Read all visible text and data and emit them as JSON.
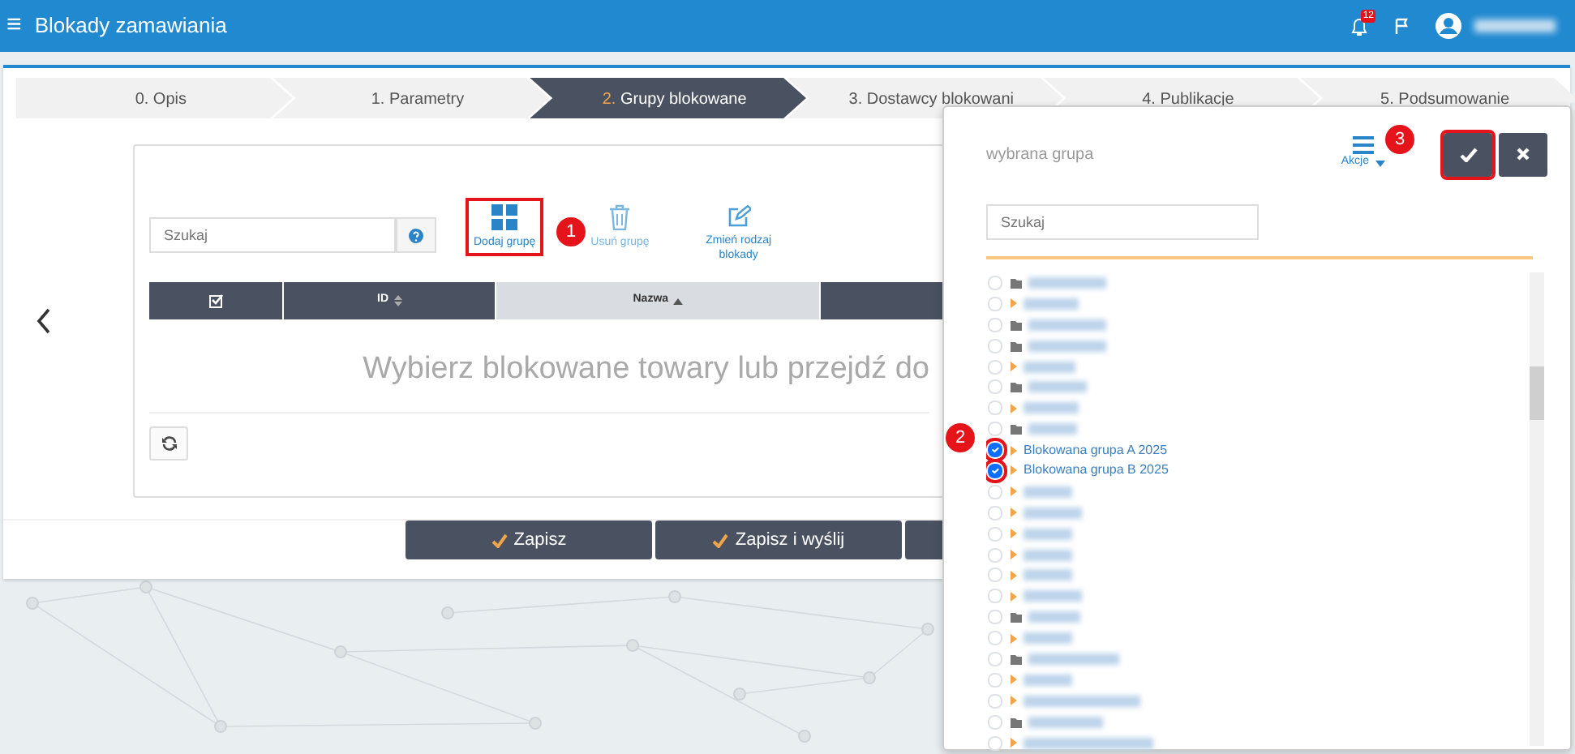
{
  "app": {
    "menu_icon": "≡",
    "title": "Blokady zamawiania",
    "notifications": "12"
  },
  "steps": [
    {
      "number": "0.",
      "label": "Opis",
      "selected": false
    },
    {
      "number": "1.",
      "label": "Parametry",
      "selected": false
    },
    {
      "number": "2.",
      "label": "Grupy blokowane",
      "selected": true
    },
    {
      "number": "3.",
      "label": "Dostawcy blokowani",
      "selected": false
    },
    {
      "number": "4.",
      "label": "Publikacje",
      "selected": false
    },
    {
      "number": "5.",
      "label": "Podsumowanie",
      "selected": false
    }
  ],
  "toolbar": {
    "search": {
      "placeholder": "Szukaj"
    },
    "actions": [
      {
        "kind": "add",
        "label": "Dodaj grupę",
        "highlighted": true
      },
      {
        "kind": "delete",
        "label": "Usuń grupę",
        "highlighted": false
      },
      {
        "kind": "edit",
        "label": "Zmień rodzaj blokady",
        "highlighted": false
      }
    ]
  },
  "table": {
    "columns": [
      {
        "kind": "select",
        "sorted": false
      },
      {
        "kind": "text",
        "label": "ID",
        "sorted": false
      },
      {
        "kind": "text",
        "label": "Nazwa",
        "sorted": true
      },
      {
        "kind": "blank",
        "sorted": false
      }
    ],
    "empty_message": "Wybierz blokowane towary lub przejdź do"
  },
  "footer_buttons": [
    "Zapisz",
    "Zapisz i wyślij"
  ],
  "modal": {
    "title": "wybrana grupa",
    "menu_label": "Akcje",
    "confirm_highlighted": true,
    "search": {
      "placeholder": "Szukaj"
    },
    "items": [
      {
        "kind": "folder",
        "checked": false,
        "highlighted": false
      },
      {
        "kind": "branch",
        "checked": false,
        "highlighted": false
      },
      {
        "kind": "folder",
        "checked": false,
        "highlighted": false
      },
      {
        "kind": "folder",
        "checked": false,
        "highlighted": false
      },
      {
        "kind": "branch",
        "checked": false,
        "highlighted": false
      },
      {
        "kind": "folder",
        "checked": false,
        "highlighted": false
      },
      {
        "kind": "branch",
        "checked": false,
        "highlighted": false
      },
      {
        "kind": "folder",
        "checked": false,
        "highlighted": false
      },
      {
        "kind": "branch",
        "label": "Blokowana grupa A 2025",
        "checked": true,
        "highlighted": true
      },
      {
        "kind": "branch",
        "label": "Blokowana grupa B 2025",
        "checked": true,
        "highlighted": true
      },
      {
        "kind": "branch",
        "checked": false,
        "highlighted": false
      },
      {
        "kind": "branch",
        "checked": false,
        "highlighted": false
      },
      {
        "kind": "branch",
        "checked": false,
        "highlighted": false
      },
      {
        "kind": "branch",
        "checked": false,
        "highlighted": false
      },
      {
        "kind": "branch",
        "checked": false,
        "highlighted": false
      },
      {
        "kind": "branch",
        "checked": false,
        "highlighted": false
      },
      {
        "kind": "folder",
        "checked": false,
        "highlighted": false
      },
      {
        "kind": "branch",
        "checked": false,
        "highlighted": false
      },
      {
        "kind": "folder",
        "checked": false,
        "highlighted": false
      },
      {
        "kind": "branch",
        "checked": false,
        "highlighted": false
      },
      {
        "kind": "branch",
        "checked": false,
        "highlighted": false
      },
      {
        "kind": "folder",
        "checked": false,
        "highlighted": false
      },
      {
        "kind": "branch",
        "checked": false,
        "highlighted": false
      }
    ]
  },
  "annotations": [
    {
      "number": "1"
    },
    {
      "number": "2"
    },
    {
      "number": "3"
    }
  ]
}
